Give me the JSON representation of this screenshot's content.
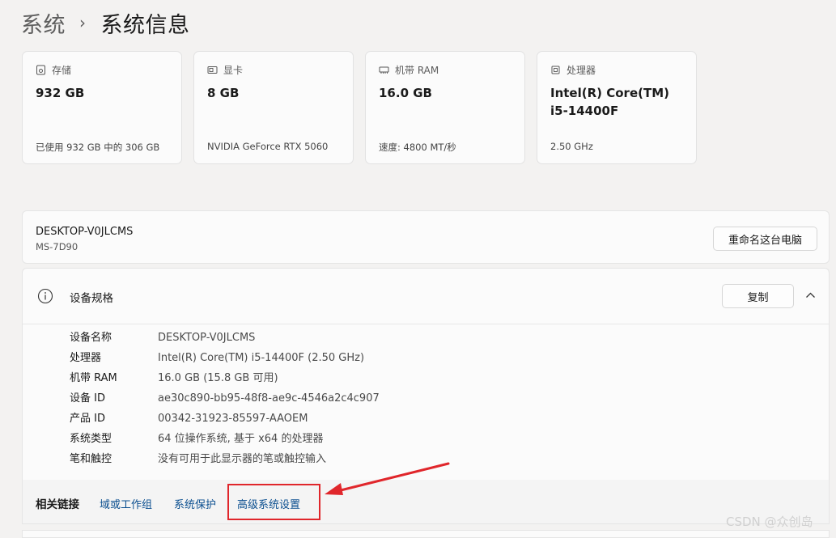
{
  "breadcrumb": {
    "root": "系统",
    "current": "系统信息"
  },
  "cards": [
    {
      "icon": "storage-icon",
      "label": "存储",
      "value": "932 GB",
      "sub": "已使用 932 GB 中的 306 GB"
    },
    {
      "icon": "graphics-card-icon",
      "label": "显卡",
      "value": "8 GB",
      "sub": "NVIDIA GeForce RTX 5060"
    },
    {
      "icon": "memory-icon",
      "label": "机带 RAM",
      "value": "16.0 GB",
      "sub": "速度: 4800 MT/秒"
    },
    {
      "icon": "processor-icon",
      "label": "处理器",
      "value_line1": "Intel(R) Core(TM)",
      "value_line2": "i5-14400F",
      "sub": "2.50 GHz"
    }
  ],
  "device": {
    "name": "DESKTOP-V0JLCMS",
    "model": "MS-7D90",
    "rename_label": "重命名这台电脑"
  },
  "specs": {
    "title": "设备规格",
    "copy_label": "复制",
    "rows": [
      {
        "key": "设备名称",
        "value": "DESKTOP-V0JLCMS"
      },
      {
        "key": "处理器",
        "value": "Intel(R) Core(TM) i5-14400F (2.50 GHz)"
      },
      {
        "key": "机带 RAM",
        "value": "16.0 GB (15.8 GB 可用)"
      },
      {
        "key": "设备 ID",
        "value": "ae30c890-bb95-48f8-ae9c-4546a2c4c907"
      },
      {
        "key": "产品 ID",
        "value": "00342-31923-85597-AAOEM"
      },
      {
        "key": "系统类型",
        "value": "64 位操作系统, 基于 x64 的处理器"
      },
      {
        "key": "笔和触控",
        "value": "没有可用于此显示器的笔或触控输入"
      }
    ]
  },
  "related": {
    "label": "相关链接",
    "links": [
      "域或工作组",
      "系统保护",
      "高级系统设置"
    ]
  },
  "annotation_color": "#e0262b",
  "link_color": "#0a4e8f",
  "watermark": "CSDN @众创岛"
}
